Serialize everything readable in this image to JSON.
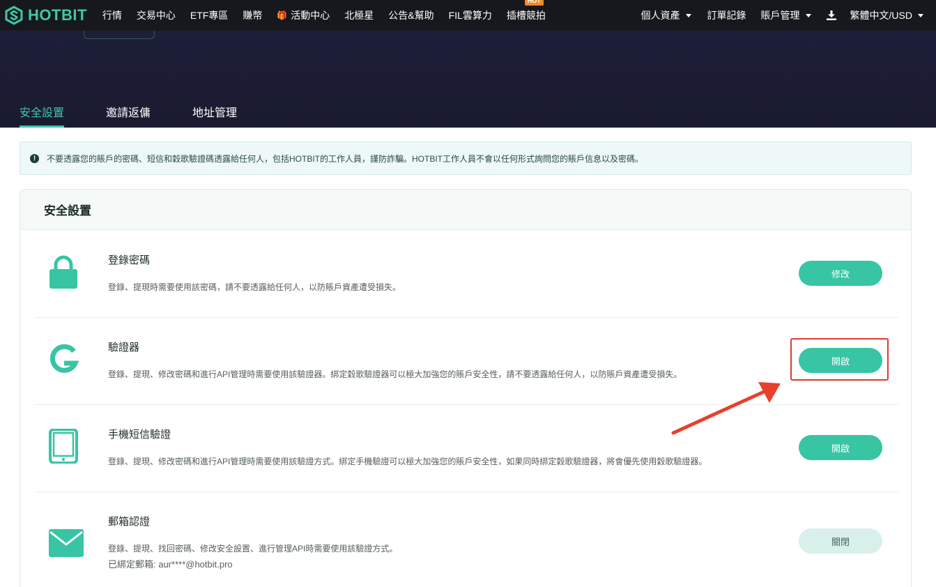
{
  "brand": {
    "name": "HOTBIT",
    "color": "#3ec8a6"
  },
  "nav": {
    "items": [
      {
        "label": "行情"
      },
      {
        "label": "交易中心"
      },
      {
        "label": "ETF專區"
      },
      {
        "label": "賺幣"
      },
      {
        "label": "活動中心",
        "icon": "gift-icon"
      },
      {
        "label": "北極星"
      },
      {
        "label": "公告&幫助"
      },
      {
        "label": "FIL雲算力"
      },
      {
        "label": "插槽競拍",
        "badge": "HOT"
      }
    ],
    "right": {
      "assets": "個人資產",
      "orders": "訂單記錄",
      "account": "賬戶管理",
      "language": "繁體中文/USD"
    }
  },
  "tabs": [
    {
      "label": "安全設置",
      "active": true
    },
    {
      "label": "邀請返傭"
    },
    {
      "label": "地址管理"
    }
  ],
  "notice": "不要透露您的賬戶的密碼、短信和穀歌驗證碼透露給任何人，包括HOTBIT的工作人員，謹防詐騙。HOTBIT工作人員不會以任何形式詢問您的賬戶信息以及密碼。",
  "security": {
    "title": "安全設置",
    "rows": [
      {
        "icon": "lock-icon",
        "title": "登錄密碼",
        "desc": "登錄、提現時需要使用該密碼，請不要透露給任何人，以防賬戶資產遭受損失。",
        "button": "修改"
      },
      {
        "icon": "google-g-icon",
        "title": "驗證器",
        "desc": "登錄、提現、修改密碼和進行API管理時需要使用該驗證器。綁定穀歌驗證器可以極大加強您的賬戶安全性，請不要透露給任何人，以防賬戶資產遭受損失。",
        "button": "開啟"
      },
      {
        "icon": "tablet-icon",
        "title": "手機短信驗證",
        "desc": "登錄、提現、修改密碼和進行API管理時需要使用該驗證方式。綁定手機驗證可以極大加強您的賬戶安全性，如果同時綁定穀歌驗證器，將會優先使用穀歌驗證器。",
        "button": "開啟"
      },
      {
        "icon": "envelope-icon",
        "title": "郵箱認證",
        "desc": "登錄、提現、找回密碼、修改安全設置、進行管理API時需要使用該驗證方式。",
        "desc2": "已綁定郵箱: aur****@hotbit.pro",
        "button": "關閉"
      }
    ]
  },
  "colors": {
    "accent": "#38c5a4",
    "nav_bg": "#17181e",
    "banner_bg": "#1c1d33",
    "annotation": "#e03a2a"
  }
}
